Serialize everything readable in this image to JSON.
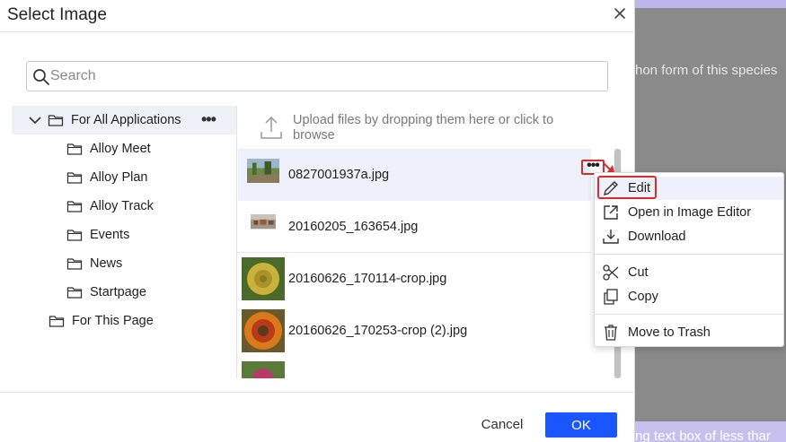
{
  "background": {
    "line1": "hon form of this species",
    "line2": "ng text box of less thar"
  },
  "dialog": {
    "title": "Select Image",
    "close": "×"
  },
  "search": {
    "placeholder": "Search",
    "value": ""
  },
  "tree": {
    "root": {
      "label": "For All Applications",
      "more": "•••"
    },
    "children": [
      {
        "label": "Alloy Meet"
      },
      {
        "label": "Alloy Plan"
      },
      {
        "label": "Alloy Track"
      },
      {
        "label": "Events"
      },
      {
        "label": "News"
      },
      {
        "label": "Startpage"
      }
    ],
    "page": {
      "label": "For This Page"
    }
  },
  "upload": {
    "text": "Upload files by dropping them here or click to browse"
  },
  "files": [
    {
      "name": "0827001937a.jpg",
      "more": "•••"
    },
    {
      "name": "20160205_163654.jpg"
    },
    {
      "name": "20160626_170114-crop.jpg"
    },
    {
      "name": "20160626_170253-crop (2).jpg"
    },
    {
      "name": ""
    }
  ],
  "context_menu": {
    "items": [
      {
        "label": "Edit",
        "icon": "pencil-icon"
      },
      {
        "label": "Open in Image Editor",
        "icon": "external-link-icon"
      },
      {
        "label": "Download",
        "icon": "download-icon"
      },
      {
        "label": "Cut",
        "icon": "scissors-icon"
      },
      {
        "label": "Copy",
        "icon": "copy-icon"
      },
      {
        "label": "Move to Trash",
        "icon": "trash-icon"
      }
    ]
  },
  "footer": {
    "cancel": "Cancel",
    "ok": "OK"
  },
  "colors": {
    "primary": "#1a56ff",
    "highlight": "#d92d2d",
    "selected_bg": "#eef1fb"
  }
}
